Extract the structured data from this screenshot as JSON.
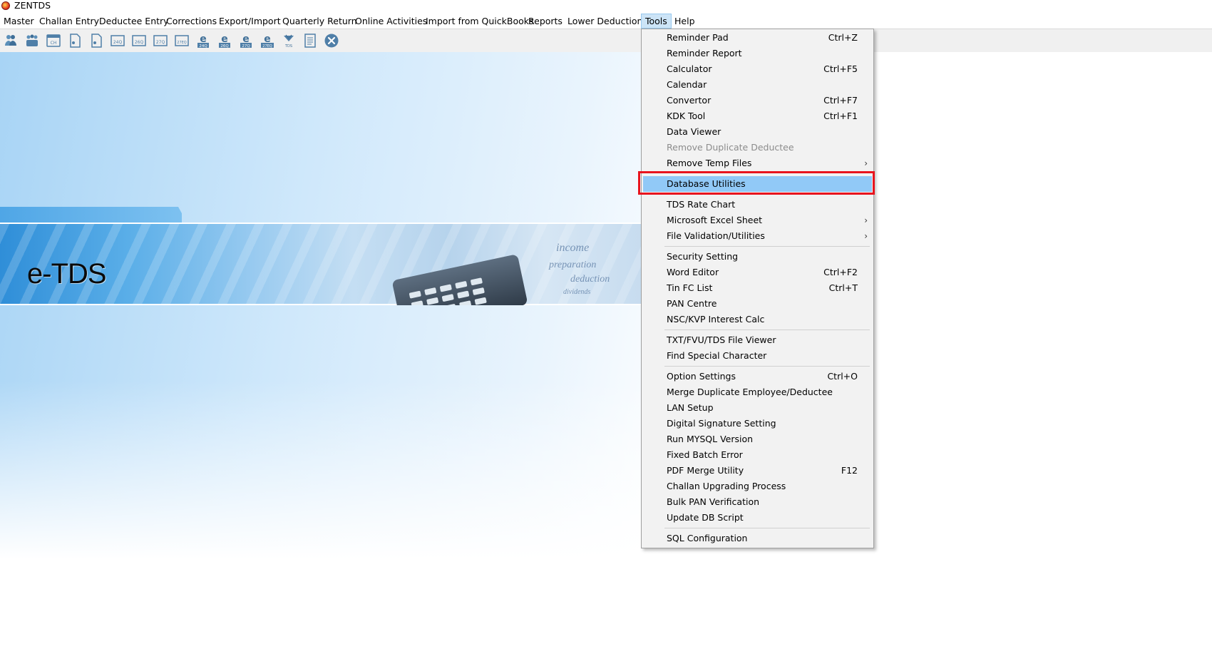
{
  "window": {
    "title": "ZENTDS"
  },
  "menubar": {
    "items": [
      {
        "label": "Master"
      },
      {
        "label": "Challan Entry"
      },
      {
        "label": "Deductee Entry"
      },
      {
        "label": "Corrections"
      },
      {
        "label": "Export/Import"
      },
      {
        "label": "Quarterly Return"
      },
      {
        "label": "Online Activities"
      },
      {
        "label": "Import from QuickBooks"
      },
      {
        "label": "Reports"
      },
      {
        "label": "Lower Deductions"
      },
      {
        "label": "Tools",
        "active": true
      },
      {
        "label": "Help"
      }
    ]
  },
  "toolbar": {
    "icons": [
      {
        "name": "deductor-icon"
      },
      {
        "name": "deductees-icon"
      },
      {
        "name": "challan-icon",
        "text": "CH"
      },
      {
        "name": "document-icon"
      },
      {
        "name": "document-icon"
      },
      {
        "name": "form-24q-icon",
        "text": "24Q"
      },
      {
        "name": "form-26q-icon",
        "text": "26Q"
      },
      {
        "name": "form-27q-icon",
        "text": "27Q"
      },
      {
        "name": "form-27eq-icon",
        "text": "27EQ"
      },
      {
        "name": "efile-24q-icon",
        "text": "24Q"
      },
      {
        "name": "efile-26q-icon",
        "text": "26Q"
      },
      {
        "name": "efile-27q-icon",
        "text": "27Q"
      },
      {
        "name": "efile-27eq-icon",
        "text": "27EQ"
      },
      {
        "name": "tds-logo-icon",
        "text": "TDS"
      },
      {
        "name": "notepad-icon"
      },
      {
        "name": "close-icon"
      }
    ]
  },
  "banner": {
    "title": "e-TDS"
  },
  "tools_menu": {
    "items": [
      {
        "label": "Reminder Pad",
        "shortcut": "Ctrl+Z"
      },
      {
        "label": "Reminder Report",
        "shortcut": ""
      },
      {
        "label": "Calculator",
        "shortcut": "Ctrl+F5"
      },
      {
        "label": "Calendar",
        "shortcut": ""
      },
      {
        "label": "Convertor",
        "shortcut": "Ctrl+F7"
      },
      {
        "label": "KDK Tool",
        "shortcut": "Ctrl+F1"
      },
      {
        "label": "Data Viewer",
        "shortcut": ""
      },
      {
        "label": "Remove Duplicate Deductee",
        "shortcut": "",
        "disabled": true
      },
      {
        "label": "Remove Temp Files",
        "shortcut": "",
        "submenu": true
      },
      {
        "label": "Database Utilities",
        "shortcut": "",
        "highlighted": true
      },
      {
        "label": "TDS Rate Chart",
        "shortcut": ""
      },
      {
        "label": "Microsoft Excel Sheet",
        "shortcut": "",
        "submenu": true
      },
      {
        "label": "File Validation/Utilities",
        "shortcut": "",
        "submenu": true
      },
      {
        "label": "Security Setting",
        "shortcut": ""
      },
      {
        "label": "Word Editor",
        "shortcut": "Ctrl+F2"
      },
      {
        "label": "Tin FC List",
        "shortcut": "Ctrl+T"
      },
      {
        "label": "PAN Centre",
        "shortcut": ""
      },
      {
        "label": "NSC/KVP Interest Calc",
        "shortcut": ""
      },
      {
        "label": "TXT/FVU/TDS File Viewer",
        "shortcut": ""
      },
      {
        "label": "Find Special Character",
        "shortcut": ""
      },
      {
        "label": "Option Settings",
        "shortcut": "Ctrl+O"
      },
      {
        "label": "Merge Duplicate Employee/Deductee",
        "shortcut": ""
      },
      {
        "label": "LAN Setup",
        "shortcut": ""
      },
      {
        "label": "Digital Signature Setting",
        "shortcut": ""
      },
      {
        "label": "Run MYSQL Version",
        "shortcut": ""
      },
      {
        "label": "Fixed Batch Error",
        "shortcut": ""
      },
      {
        "label": "PDF Merge Utility",
        "shortcut": "F12"
      },
      {
        "label": "Challan Upgrading Process",
        "shortcut": ""
      },
      {
        "label": "Bulk PAN Verification",
        "shortcut": ""
      },
      {
        "label": "Update DB Script",
        "shortcut": ""
      },
      {
        "label": "SQL Configuration",
        "shortcut": ""
      }
    ],
    "submenu_arrow": "›",
    "highlight_color": "#91c9f7",
    "annotation_color": "#e8141e"
  }
}
